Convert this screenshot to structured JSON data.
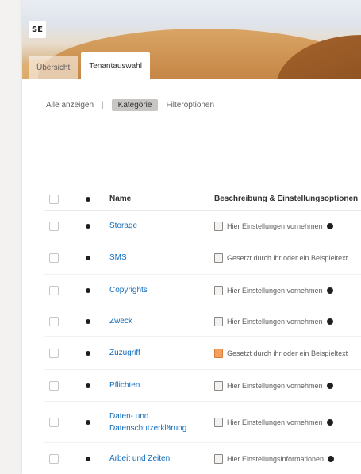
{
  "app": {
    "logo_text": "SE"
  },
  "tabs": [
    {
      "label": "Übersicht",
      "active": false
    },
    {
      "label": "Tenantauswahl",
      "active": true
    }
  ],
  "filter": {
    "scope_label": "Alle anzeigen",
    "selected_label": "Kategorie",
    "extra_label": "Filteroptionen"
  },
  "table": {
    "headers": {
      "name": "Name",
      "description": "Beschreibung & Einstellungsoptionen"
    },
    "rows": [
      {
        "name": "Storage",
        "description": "Hier Einstellungen vornehmen",
        "icon": "doc-icon",
        "has_info": true
      },
      {
        "name": "SMS",
        "description": "Gesetzt durch ihr oder ein Beispieltext",
        "icon": "doc-icon",
        "has_info": false
      },
      {
        "name": "Copyrights",
        "description": "Hier Einstellungen vornehmen",
        "icon": "doc-icon",
        "has_info": true
      },
      {
        "name": "Zweck",
        "description": "Hier Einstellungen vornehmen",
        "icon": "doc-icon",
        "has_info": true
      },
      {
        "name": "Zuzugriff",
        "description": "Gesetzt durch ihr oder ein Beispieltext",
        "icon": "warning-doc-icon",
        "has_info": false
      },
      {
        "name": "Pflichten",
        "description": "Hier Einstellungen vornehmen",
        "icon": "doc-icon",
        "has_info": true
      },
      {
        "name": "Daten- und Datenschutzerklärung",
        "description": "Hier Einstellungen vornehmen",
        "icon": "doc-icon",
        "has_info": true
      },
      {
        "name": "Arbeit und Zeiten",
        "description": "Hier Einstellungsinformationen",
        "icon": "doc-icon",
        "has_info": true
      }
    ]
  },
  "colors": {
    "accent": "#0f6cbd",
    "warning": "#f2a060"
  }
}
